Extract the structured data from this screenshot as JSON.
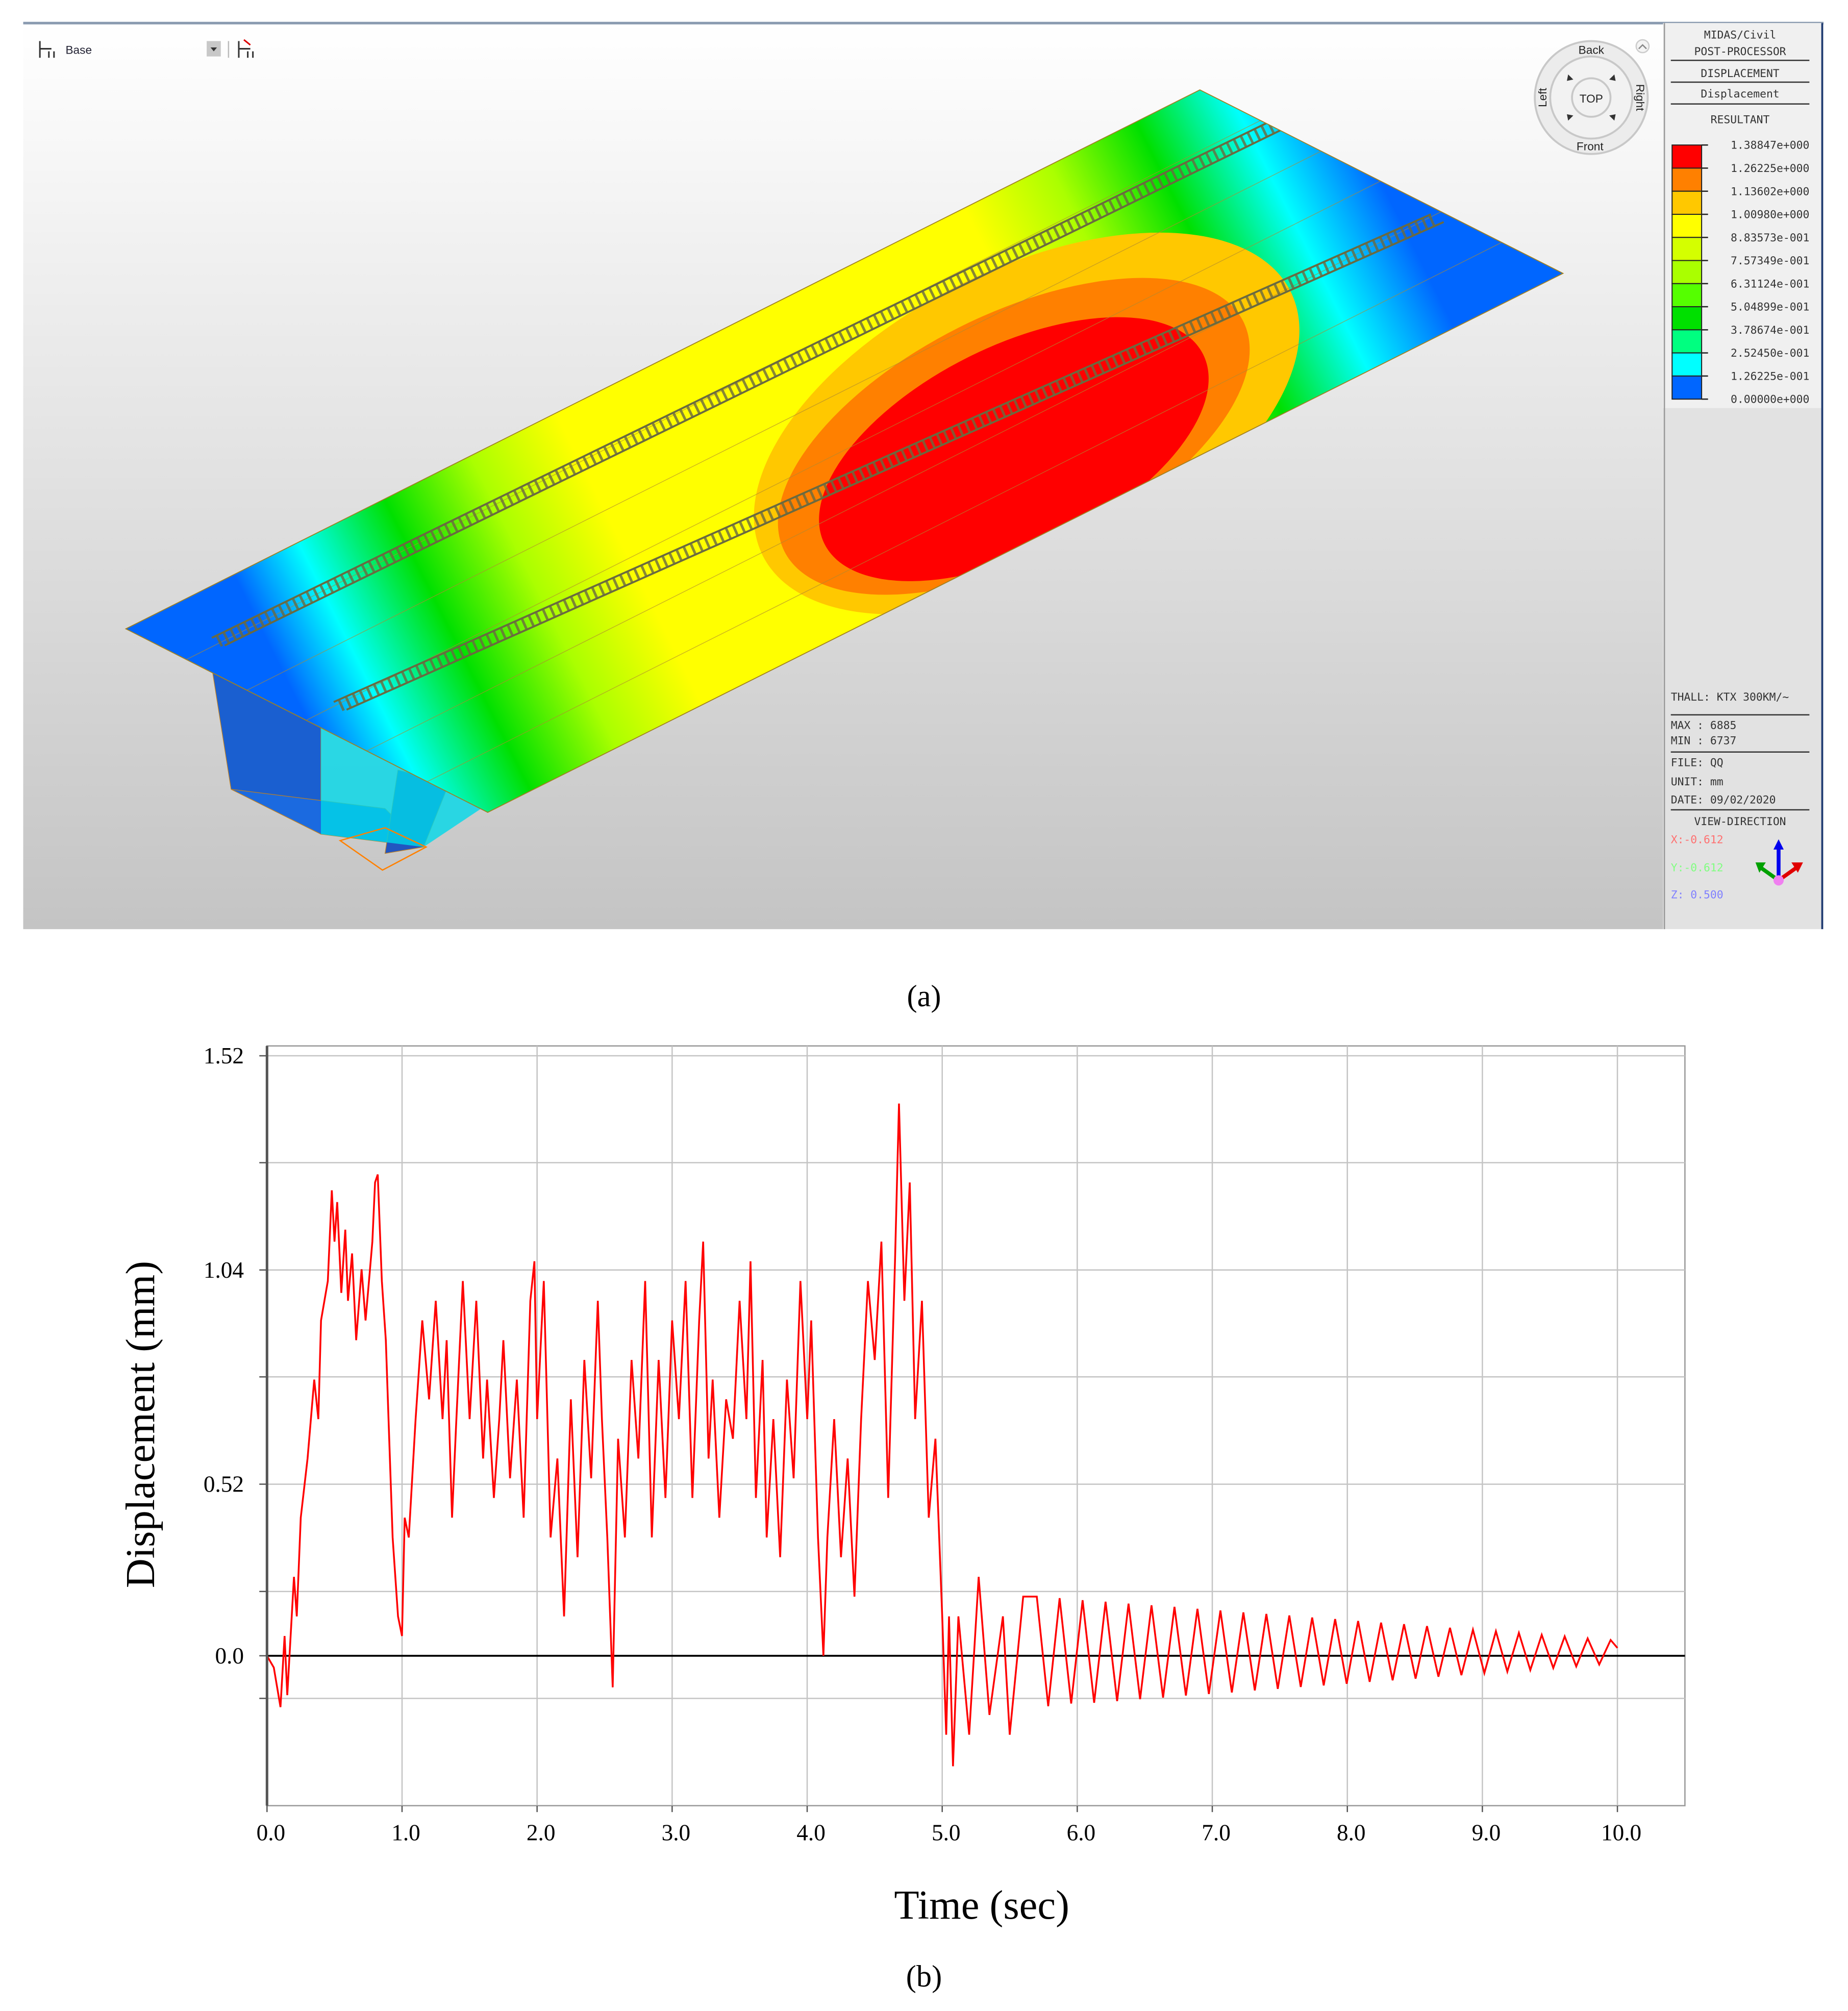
{
  "toolbar": {
    "view_label": "Base",
    "dropdown_icon": "chevron-down-icon"
  },
  "view_cube": {
    "back": "Back",
    "front": "Front",
    "left": "Left",
    "right": "Right",
    "top": "TOP"
  },
  "panel": {
    "app": "MIDAS/Civil",
    "module": "POST-PROCESSOR",
    "result_type": "DISPLACEMENT",
    "result_sub": "Displacement",
    "component": "RESULTANT",
    "legend": [
      {
        "label": "1.38847e+000",
        "color": "#FF0000"
      },
      {
        "label": "1.26225e+000",
        "color": "#FF8000"
      },
      {
        "label": "1.13602e+000",
        "color": "#FFC800"
      },
      {
        "label": "1.00980e+000",
        "color": "#FFFF00"
      },
      {
        "label": "8.83573e-001",
        "color": "#D4FF00"
      },
      {
        "label": "7.57349e-001",
        "color": "#AAFF00"
      },
      {
        "label": "6.31124e-001",
        "color": "#55FF00"
      },
      {
        "label": "5.04899e-001",
        "color": "#00E000"
      },
      {
        "label": "3.78674e-001",
        "color": "#00FF80"
      },
      {
        "label": "2.52450e-001",
        "color": "#00FFFF"
      },
      {
        "label": "1.26225e-001",
        "color": "#0066FF"
      },
      {
        "label": "0.00000e+000",
        "color": null
      }
    ],
    "thall": "THALL: KTX 300KM/~",
    "max": "MAX : 6885",
    "min": "MIN : 6737",
    "file": "FILE: QQ",
    "unit": "UNIT: mm",
    "date": "DATE: 09/02/2020",
    "view_direction": "VIEW-DIRECTION",
    "vx": "X:-0.612",
    "vy": "Y:-0.612",
    "vz": "Z: 0.500"
  },
  "captions": {
    "a": "(a)",
    "b": "(b)"
  },
  "chart_data": {
    "type": "line",
    "title": "",
    "xlabel": "Time (sec)",
    "ylabel": "Displacement (mm)",
    "xlim": [
      0,
      10.5
    ],
    "ylim": [
      -0.38,
      1.546
    ],
    "grid": true,
    "line_color": "#FF0000",
    "xticks": [
      {
        "value": 0,
        "label": "0.0"
      },
      {
        "value": 1,
        "label": "1.0"
      },
      {
        "value": 2,
        "label": "2.0"
      },
      {
        "value": 3,
        "label": "3.0"
      },
      {
        "value": 4,
        "label": "4.0"
      },
      {
        "value": 5,
        "label": "5.0"
      },
      {
        "value": 6,
        "label": "6.0"
      },
      {
        "value": 7,
        "label": "7.0"
      },
      {
        "value": 8,
        "label": "8.0"
      },
      {
        "value": 9,
        "label": "9.0"
      },
      {
        "value": 10,
        "label": "10.0"
      }
    ],
    "yticks": [
      {
        "value": 1.521,
        "label": "1.52"
      },
      {
        "value": 1.25,
        "label": ""
      },
      {
        "value": 0.978,
        "label": "1.04"
      },
      {
        "value": 0.707,
        "label": ""
      },
      {
        "value": 0.435,
        "label": "0.52"
      },
      {
        "value": 0.163,
        "label": ""
      },
      {
        "value": 0,
        "label": "0.0"
      },
      {
        "value": -0.108,
        "label": ""
      }
    ],
    "series": [
      {
        "name": "Displacement",
        "x": [
          0,
          0.05,
          0.1,
          0.13,
          0.15,
          0.2,
          0.22,
          0.25,
          0.3,
          0.35,
          0.38,
          0.4,
          0.45,
          0.48,
          0.5,
          0.52,
          0.55,
          0.58,
          0.6,
          0.63,
          0.66,
          0.7,
          0.73,
          0.76,
          0.78,
          0.8,
          0.82,
          0.85,
          0.88,
          0.9,
          0.93,
          0.97,
          1.0,
          1.02,
          1.05,
          1.1,
          1.15,
          1.2,
          1.25,
          1.3,
          1.33,
          1.37,
          1.4,
          1.45,
          1.5,
          1.55,
          1.6,
          1.63,
          1.68,
          1.72,
          1.75,
          1.8,
          1.85,
          1.9,
          1.95,
          1.98,
          2.0,
          2.05,
          2.1,
          2.15,
          2.2,
          2.25,
          2.3,
          2.35,
          2.4,
          2.45,
          2.48,
          2.52,
          2.56,
          2.6,
          2.65,
          2.7,
          2.75,
          2.8,
          2.85,
          2.9,
          2.95,
          3.0,
          3.05,
          3.1,
          3.15,
          3.2,
          3.23,
          3.27,
          3.3,
          3.35,
          3.4,
          3.45,
          3.5,
          3.55,
          3.58,
          3.62,
          3.67,
          3.7,
          3.75,
          3.8,
          3.85,
          3.9,
          3.95,
          4.0,
          4.03,
          4.08,
          4.12,
          4.15,
          4.2,
          4.25,
          4.3,
          4.35,
          4.4,
          4.45,
          4.5,
          4.55,
          4.6,
          4.65,
          4.68,
          4.72,
          4.76,
          4.8,
          4.85,
          4.9,
          4.95,
          5.0,
          5.03,
          5.05,
          5.08,
          5.12,
          5.2,
          5.27,
          5.35,
          5.45,
          5.5,
          5.6,
          5.7,
          5.785,
          5.87,
          5.955,
          6.04,
          6.125,
          6.21,
          6.295,
          6.38,
          6.465,
          6.55,
          6.635,
          6.72,
          6.805,
          6.89,
          6.975,
          7.06,
          7.145,
          7.23,
          7.315,
          7.4,
          7.485,
          7.57,
          7.655,
          7.74,
          7.825,
          7.91,
          7.995,
          8.08,
          8.165,
          8.25,
          8.335,
          8.42,
          8.505,
          8.59,
          8.675,
          8.76,
          8.845,
          8.93,
          9.015,
          9.1,
          9.185,
          9.27,
          9.355,
          9.44,
          9.525,
          9.61,
          9.695,
          9.78,
          9.865,
          9.95,
          10.0
        ],
        "y": [
          0,
          -0.03,
          -0.13,
          0.05,
          -0.1,
          0.2,
          0.1,
          0.35,
          0.5,
          0.7,
          0.6,
          0.85,
          0.95,
          1.18,
          1.05,
          1.15,
          0.92,
          1.08,
          0.9,
          1.02,
          0.8,
          0.98,
          0.85,
          0.97,
          1.05,
          1.2,
          1.22,
          0.95,
          0.8,
          0.6,
          0.3,
          0.1,
          0.05,
          0.35,
          0.3,
          0.6,
          0.85,
          0.65,
          0.9,
          0.6,
          0.8,
          0.35,
          0.58,
          0.95,
          0.6,
          0.9,
          0.5,
          0.7,
          0.4,
          0.6,
          0.8,
          0.45,
          0.7,
          0.35,
          0.9,
          1.0,
          0.6,
          0.95,
          0.3,
          0.5,
          0.1,
          0.65,
          0.25,
          0.75,
          0.45,
          0.9,
          0.6,
          0.3,
          -0.08,
          0.55,
          0.3,
          0.75,
          0.5,
          0.95,
          0.3,
          0.75,
          0.4,
          0.85,
          0.6,
          0.95,
          0.4,
          0.85,
          1.05,
          0.5,
          0.7,
          0.35,
          0.65,
          0.55,
          0.9,
          0.6,
          1.0,
          0.4,
          0.75,
          0.3,
          0.6,
          0.25,
          0.7,
          0.45,
          0.95,
          0.6,
          0.85,
          0.3,
          0.0,
          0.3,
          0.6,
          0.25,
          0.5,
          0.15,
          0.6,
          0.95,
          0.75,
          1.05,
          0.4,
          1.0,
          1.4,
          0.9,
          1.2,
          0.6,
          0.9,
          0.35,
          0.55,
          0.1,
          -0.2,
          0.1,
          -0.28,
          0.1,
          -0.2,
          0.2,
          -0.15,
          0.1,
          -0.2,
          0.15,
          0.15,
          -0.128,
          0.146,
          -0.121,
          0.141,
          -0.119,
          0.137,
          -0.115,
          0.132,
          -0.11,
          0.128,
          -0.106,
          0.124,
          -0.101,
          0.119,
          -0.097,
          0.115,
          -0.093,
          0.11,
          -0.088,
          0.106,
          -0.084,
          0.102,
          -0.079,
          0.097,
          -0.075,
          0.093,
          -0.071,
          0.088,
          -0.066,
          0.084,
          -0.062,
          0.08,
          -0.058,
          0.075,
          -0.053,
          0.071,
          -0.049,
          0.066,
          -0.044,
          0.062,
          -0.04,
          0.058,
          -0.036,
          0.053,
          -0.031,
          0.049,
          -0.027,
          0.044,
          -0.022,
          0.04,
          0.02
        ]
      }
    ]
  }
}
